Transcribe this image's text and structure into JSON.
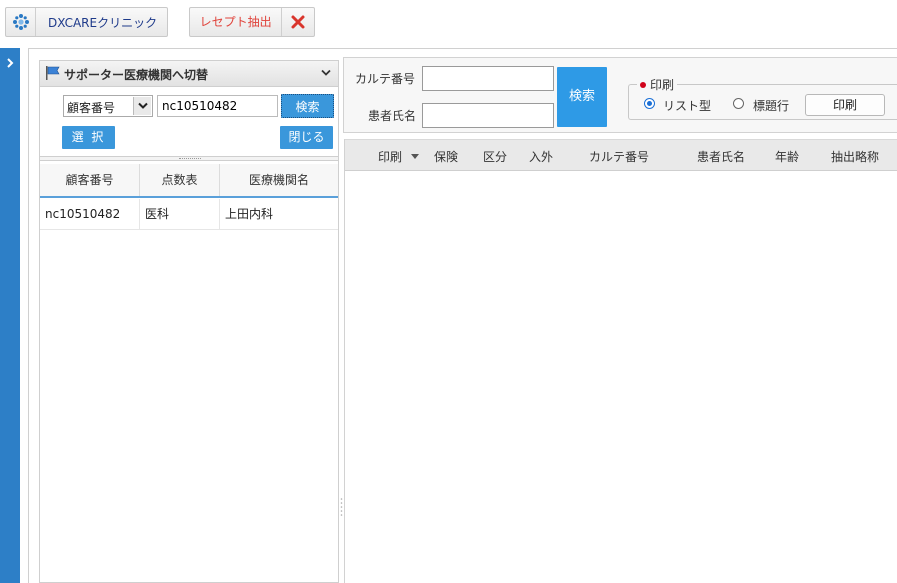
{
  "toolbar": {
    "app_label": "DXCAREクリニック",
    "receipt_label": "レセプト抽出"
  },
  "left_panel": {
    "title": "サポーター医療機関へ切替",
    "search_type": "顧客番号",
    "search_value": "nc10510482",
    "search_button": "検索",
    "select_button": "選 択",
    "close_button": "閉じる",
    "columns": [
      "顧客番号",
      "点数表",
      "医療機関名"
    ],
    "rows": [
      [
        "nc10510482",
        "医科",
        "上田内科"
      ]
    ]
  },
  "right_panel": {
    "chart_no_label": "カルテ番号",
    "patient_name_label": "患者氏名",
    "search_button": "検索",
    "print_group": {
      "legend": "印刷",
      "options": [
        "リスト型",
        "標題行"
      ],
      "selected": "リスト型",
      "print_button": "印刷"
    },
    "columns": [
      "印刷",
      "保険",
      "区分",
      "入外",
      "カルテ番号",
      "患者氏名",
      "年齢",
      "抽出略称"
    ]
  },
  "colors": {
    "accent_blue": "#3a97db",
    "strip_blue": "#2d7fc7",
    "receipt_red": "#e0433b"
  }
}
